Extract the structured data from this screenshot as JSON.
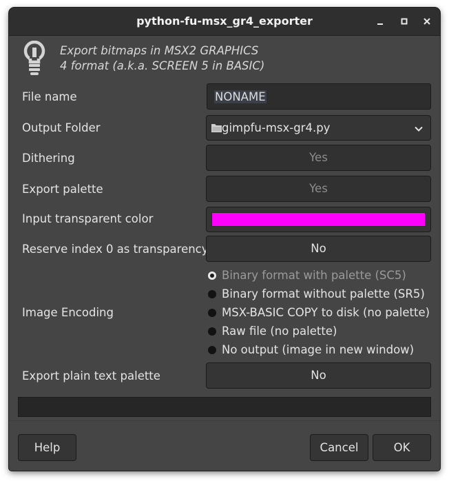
{
  "window": {
    "title": "python-fu-msx_gr4_exporter",
    "controls": [
      "minimize-icon",
      "maximize-icon",
      "close-icon"
    ]
  },
  "header": {
    "icon": "lightbulb-icon",
    "line1": "Export bitmaps in MSX2 GRAPHICS",
    "line2": "4 format (a.k.a. SCREEN 5 in BASIC)"
  },
  "form": {
    "file_name": {
      "label": "File name",
      "value": "NONAME"
    },
    "output_folder": {
      "label": "Output Folder",
      "value": "gimpfu-msx-gr4.py",
      "icon": "folder-icon"
    },
    "dithering": {
      "label": "Dithering",
      "value": "Yes"
    },
    "export_palette": {
      "label": "Export palette",
      "value": "Yes"
    },
    "transparent_color": {
      "label": "Input transparent color",
      "color": "#ff00ff"
    },
    "reserve_index": {
      "label": "Reserve index 0 as transparency",
      "value": "No"
    },
    "image_encoding": {
      "label": "Image Encoding",
      "selected_index": 0,
      "options": [
        "Binary format with palette (SC5)",
        "Binary format without palette (SR5)",
        "MSX-BASIC COPY to disk (no palette)",
        "Raw file (no palette)",
        "No output (image in new window)"
      ]
    },
    "plain_text_palette": {
      "label": "Export plain text palette",
      "value": "No"
    }
  },
  "progress": {
    "value": 0
  },
  "buttons": {
    "help": "Help",
    "cancel": "Cancel",
    "ok": "OK"
  },
  "colors": {
    "window_bg": "#454545",
    "titlebar_bg": "#2f2f2f",
    "transparent_color": "#ff00ff"
  }
}
